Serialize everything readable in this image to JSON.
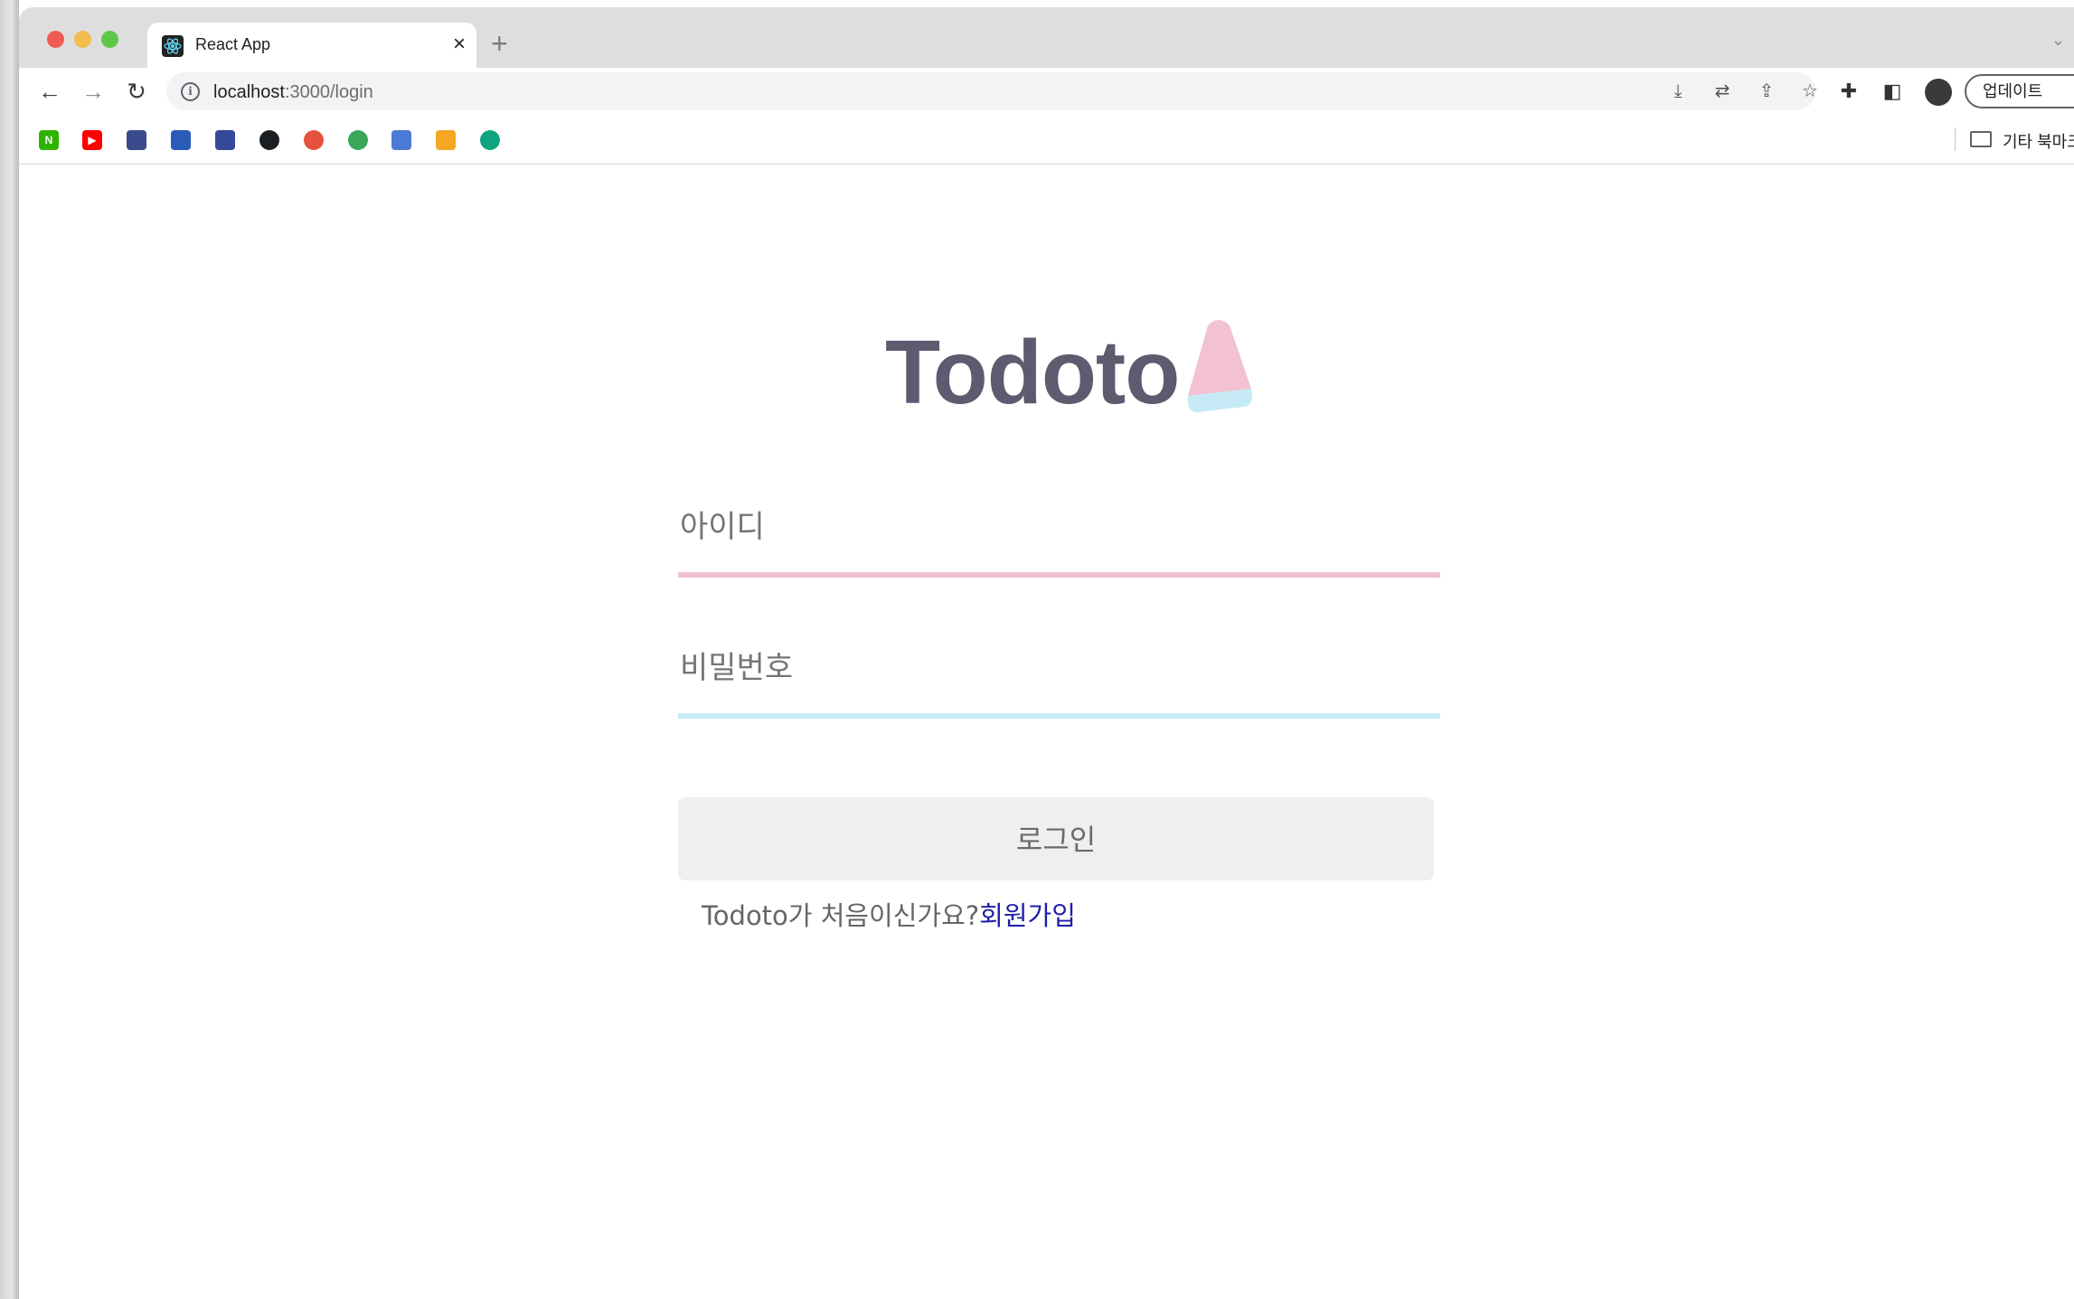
{
  "browser": {
    "tab_title": "React App",
    "tab_close": "×",
    "new_tab": "+",
    "url_host": "localhost",
    "url_rest": ":3000/login",
    "update_button": "업데이트",
    "other_bookmarks": "기타 북마크",
    "bookmarks": [
      {
        "name": "naver",
        "label": "N",
        "color": "#2db400"
      },
      {
        "name": "youtube",
        "label": "▶",
        "color": "#ff0000"
      },
      {
        "name": "site-3",
        "label": "",
        "color": "#3a4a8c"
      },
      {
        "name": "site-4",
        "label": "",
        "color": "#2a5bb8"
      },
      {
        "name": "site-5",
        "label": "",
        "color": "#36489a"
      },
      {
        "name": "github",
        "label": "",
        "color": "#1b1f23"
      },
      {
        "name": "site-7",
        "label": "",
        "color": "#e5533d"
      },
      {
        "name": "site-8",
        "label": "",
        "color": "#3aa65a"
      },
      {
        "name": "site-9",
        "label": "",
        "color": "#4b7bd6"
      },
      {
        "name": "site-10",
        "label": "",
        "color": "#f5a623"
      },
      {
        "name": "chatgpt",
        "label": "",
        "color": "#10a37f"
      }
    ]
  },
  "page": {
    "logo_text": "Todoto",
    "id_placeholder": "아이디",
    "password_placeholder": "비밀번호",
    "login_button": "로그인",
    "signup_prompt": "Todoto가 처음이신가요?",
    "signup_link": "회원가입"
  },
  "colors": {
    "logo": "#5c5b6f",
    "accent_pink": "#f2c2d2",
    "accent_blue": "#c7ebf6",
    "link": "#1d1fa8"
  }
}
